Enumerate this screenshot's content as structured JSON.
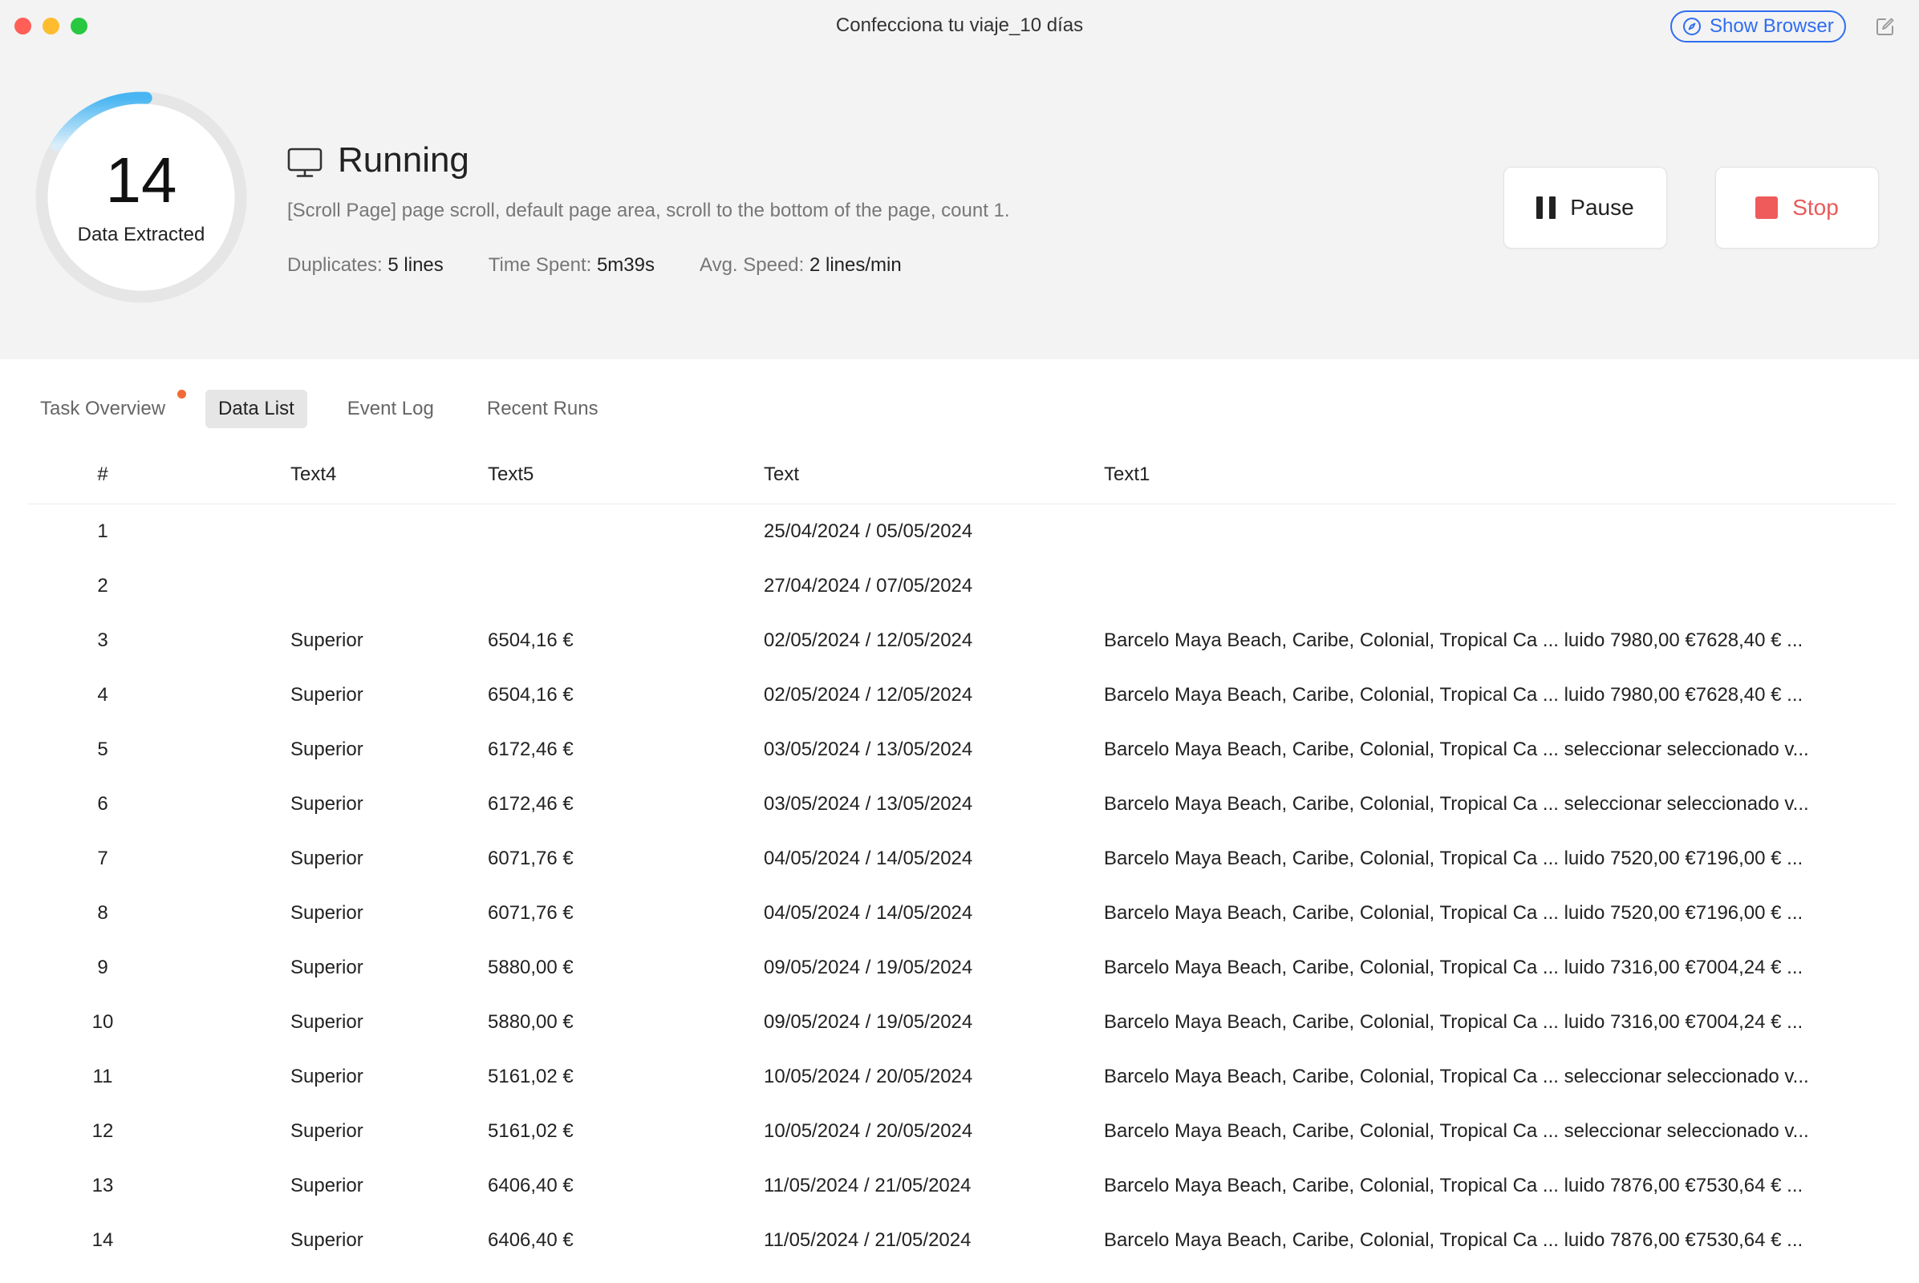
{
  "window": {
    "title": "Confecciona tu viaje_10 días",
    "show_browser_label": "Show Browser"
  },
  "summary": {
    "count": "14",
    "count_label": "Data Extracted",
    "progress_fraction": 0.17,
    "status": "Running",
    "description": "[Scroll Page] page scroll, default page area, scroll to the bottom of the page, count 1.",
    "stats": [
      {
        "label": "Duplicates:",
        "value": "5 lines"
      },
      {
        "label": "Time Spent:",
        "value": "5m39s"
      },
      {
        "label": "Avg. Speed:",
        "value": "2 lines/min"
      }
    ]
  },
  "controls": {
    "pause_label": "Pause",
    "stop_label": "Stop"
  },
  "tabs": [
    {
      "label": "Task Overview",
      "active": false,
      "has_dot": true
    },
    {
      "label": "Data List",
      "active": true,
      "has_dot": false
    },
    {
      "label": "Event Log",
      "active": false,
      "has_dot": false
    },
    {
      "label": "Recent Runs",
      "active": false,
      "has_dot": false
    }
  ],
  "table": {
    "columns": [
      "#",
      "Text4",
      "Text5",
      "Text",
      "Text1"
    ],
    "rows": [
      [
        "1",
        "",
        "",
        "25/04/2024 / 05/05/2024",
        ""
      ],
      [
        "2",
        "",
        "",
        "27/04/2024 / 07/05/2024",
        ""
      ],
      [
        "3",
        "Superior",
        "6504,16 €",
        "02/05/2024 / 12/05/2024",
        "Barcelo Maya Beach, Caribe, Colonial, Tropical Ca ... luido 7980,00 €7628,40 € ..."
      ],
      [
        "4",
        "Superior",
        "6504,16 €",
        "02/05/2024 / 12/05/2024",
        "Barcelo Maya Beach, Caribe, Colonial, Tropical Ca ... luido 7980,00 €7628,40 € ..."
      ],
      [
        "5",
        "Superior",
        "6172,46 €",
        "03/05/2024 / 13/05/2024",
        "Barcelo Maya Beach, Caribe, Colonial, Tropical Ca ... seleccionar seleccionado v..."
      ],
      [
        "6",
        "Superior",
        "6172,46 €",
        "03/05/2024 / 13/05/2024",
        "Barcelo Maya Beach, Caribe, Colonial, Tropical Ca ... seleccionar seleccionado v..."
      ],
      [
        "7",
        "Superior",
        "6071,76 €",
        "04/05/2024 / 14/05/2024",
        "Barcelo Maya Beach, Caribe, Colonial, Tropical Ca ... luido 7520,00 €7196,00 € ..."
      ],
      [
        "8",
        "Superior",
        "6071,76 €",
        "04/05/2024 / 14/05/2024",
        "Barcelo Maya Beach, Caribe, Colonial, Tropical Ca ... luido 7520,00 €7196,00 € ..."
      ],
      [
        "9",
        "Superior",
        "5880,00 €",
        "09/05/2024 / 19/05/2024",
        "Barcelo Maya Beach, Caribe, Colonial, Tropical Ca ... luido 7316,00 €7004,24 € ..."
      ],
      [
        "10",
        "Superior",
        "5880,00 €",
        "09/05/2024 / 19/05/2024",
        "Barcelo Maya Beach, Caribe, Colonial, Tropical Ca ... luido 7316,00 €7004,24 € ..."
      ],
      [
        "11",
        "Superior",
        "5161,02 €",
        "10/05/2024 / 20/05/2024",
        "Barcelo Maya Beach, Caribe, Colonial, Tropical Ca ... seleccionar seleccionado v..."
      ],
      [
        "12",
        "Superior",
        "5161,02 €",
        "10/05/2024 / 20/05/2024",
        "Barcelo Maya Beach, Caribe, Colonial, Tropical Ca ... seleccionar seleccionado v..."
      ],
      [
        "13",
        "Superior",
        "6406,40 €",
        "11/05/2024 / 21/05/2024",
        "Barcelo Maya Beach, Caribe, Colonial, Tropical Ca ... luido 7876,00 €7530,64 € ..."
      ],
      [
        "14",
        "Superior",
        "6406,40 €",
        "11/05/2024 / 21/05/2024",
        "Barcelo Maya Beach, Caribe, Colonial, Tropical Ca ... luido 7876,00 €7530,64 € ..."
      ]
    ]
  },
  "colors": {
    "accent": "#2f6df0",
    "stop": "#ef5b5b",
    "tab_dot": "#f26a36",
    "ring_progress": "#5ec5f5",
    "ring_track": "#e6e6e6"
  },
  "icons": {
    "show_browser": "compass-icon",
    "edit": "edit-icon",
    "status": "monitor-icon",
    "pause": "pause-icon",
    "stop": "stop-icon"
  }
}
